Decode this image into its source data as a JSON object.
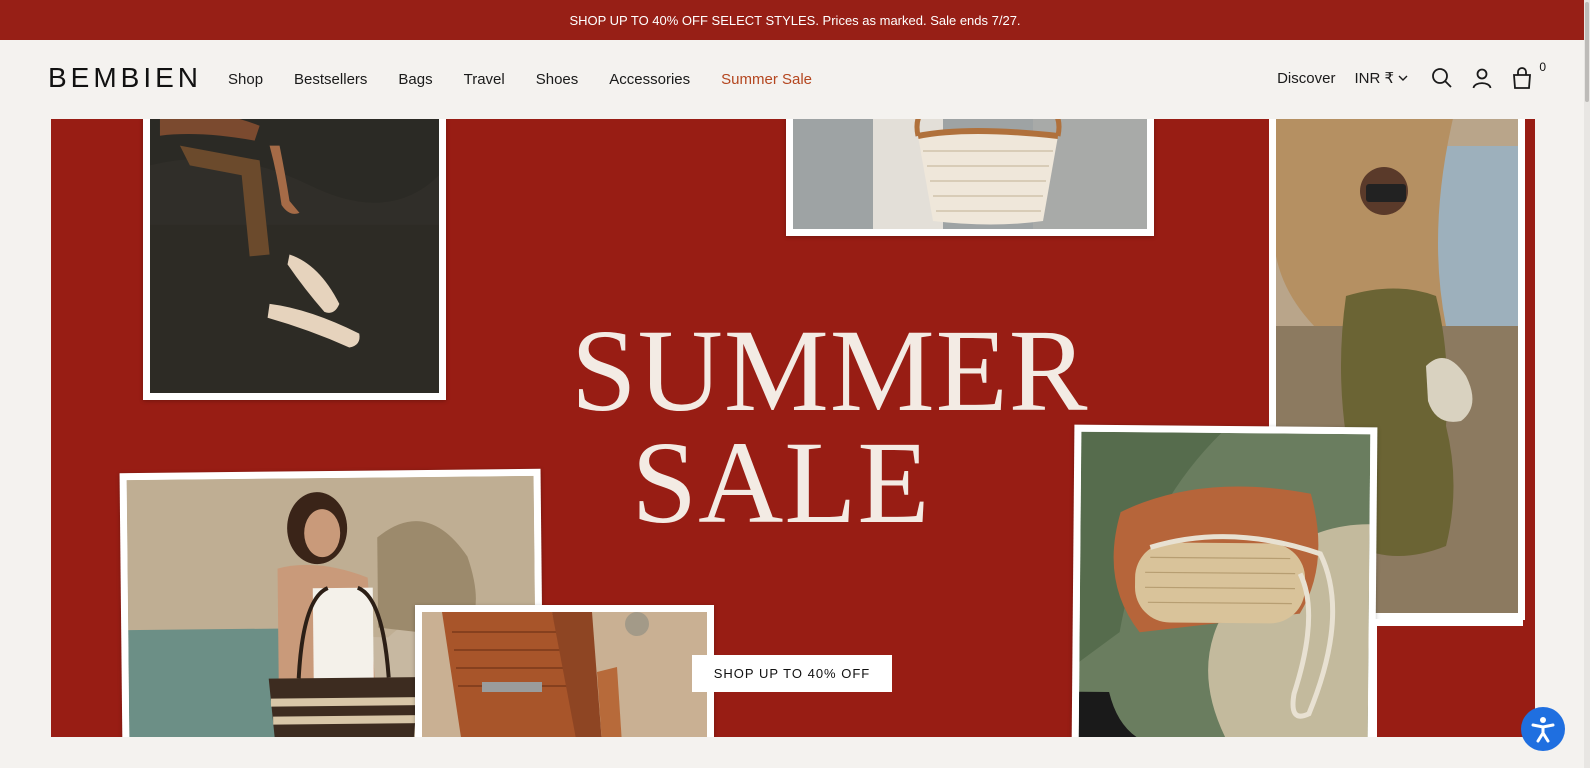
{
  "promo": {
    "text": "SHOP UP TO 40% OFF SELECT STYLES. Prices as marked. Sale ends 7/27."
  },
  "header": {
    "logo": "BEMBIEN",
    "menu": [
      {
        "label": "Shop"
      },
      {
        "label": "Bestsellers"
      },
      {
        "label": "Bags"
      },
      {
        "label": "Travel"
      },
      {
        "label": "Shoes"
      },
      {
        "label": "Accessories"
      },
      {
        "label": "Summer Sale"
      }
    ],
    "discover": "Discover",
    "currency": "INR ₹",
    "cart_count": "0",
    "icons": [
      "search-icon",
      "account-icon",
      "cart-icon",
      "chevron-down-icon"
    ]
  },
  "hero": {
    "headline_line1": "SUMMER",
    "headline_line2": "SALE",
    "cta_label": "SHOP UP TO 40% OFF",
    "background_color": "#981d14",
    "photos": [
      "sandals-on-water",
      "woven-basket-bag",
      "woman-with-camera",
      "woman-beach-tote",
      "leather-wallet",
      "raffia-crossbody-bag"
    ]
  },
  "accessibility": {
    "icon": "accessibility-icon",
    "color": "#1f6fe0"
  },
  "colors": {
    "promo": "#971f16",
    "sale_link": "#b4461f",
    "page_bg": "#f4f2ef"
  }
}
